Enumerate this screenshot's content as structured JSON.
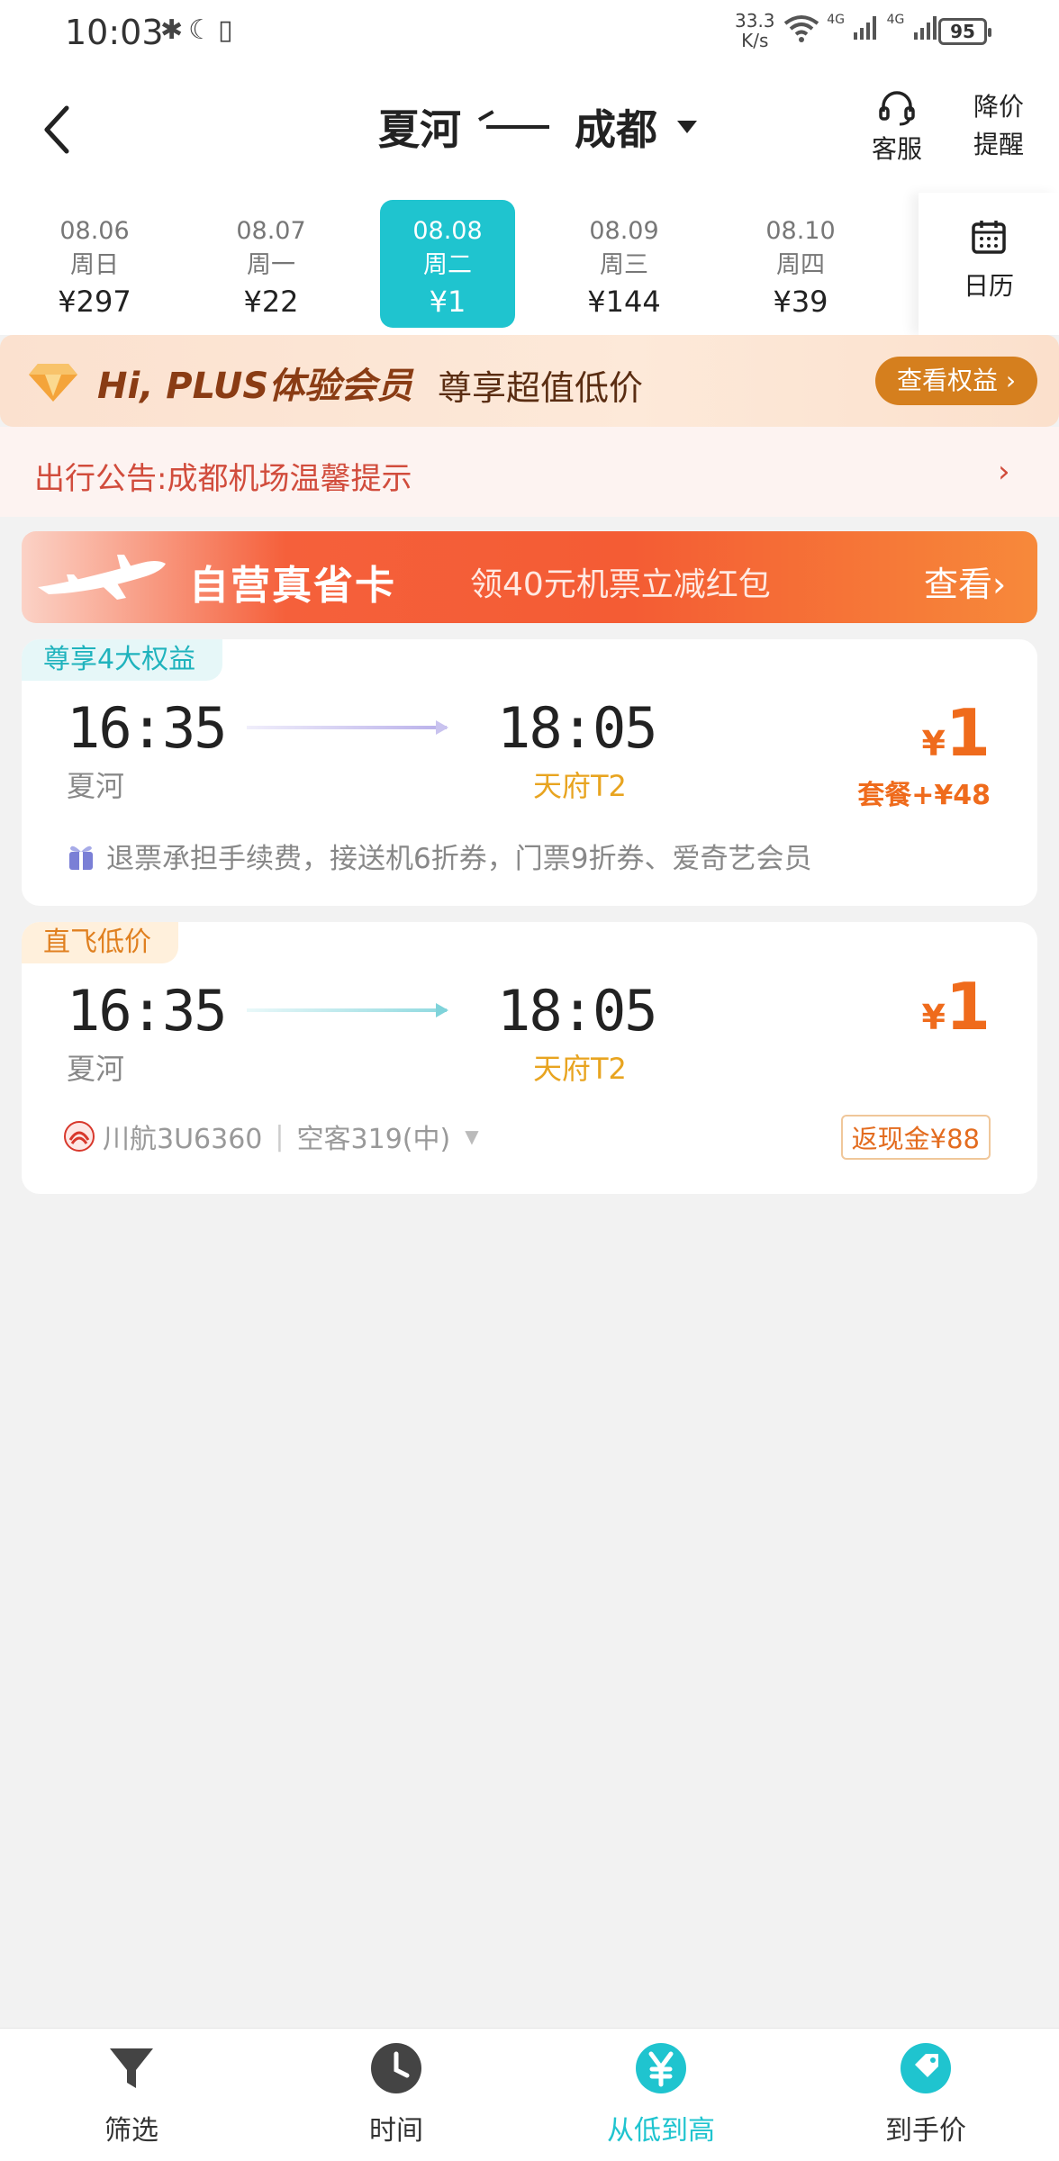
{
  "status_bar": {
    "time": "10:03",
    "net_speed_value": "33.3",
    "net_speed_unit": "K/s",
    "network_1": "4G",
    "network_2": "4G",
    "battery": "95"
  },
  "header": {
    "from": "夏河",
    "to": "成都",
    "service_label": "客服",
    "remind_label_1": "降价",
    "remind_label_2": "提醒"
  },
  "dates": [
    {
      "date": "08.06",
      "weekday": "周日",
      "price": "¥297"
    },
    {
      "date": "08.07",
      "weekday": "周一",
      "price": "¥22"
    },
    {
      "date": "08.08",
      "weekday": "周二",
      "price": "¥1",
      "selected": true
    },
    {
      "date": "08.09",
      "weekday": "周三",
      "price": "¥144"
    },
    {
      "date": "08.10",
      "weekday": "周四",
      "price": "¥39"
    }
  ],
  "calendar_label": "日历",
  "plus_banner": {
    "title": "Hi, PLUS体验会员",
    "subtitle": "尊享超值低价",
    "button": "查看权益"
  },
  "notice": {
    "text": "出行公告:成都机场温馨提示",
    "chevron": "›"
  },
  "promo": {
    "title": "自营真省卡",
    "subtitle": "领40元机票立减红包",
    "button": "查看"
  },
  "flights": [
    {
      "tag": "尊享4大权益",
      "dep_time": "16:35",
      "arr_time": "18:05",
      "dep_airport": "夏河",
      "arr_airport": "天府T2",
      "price_symbol": "¥",
      "price": "1",
      "package": "套餐+¥48",
      "benefits": "退票承担手续费，接送机6折券，门票9折券、爱奇艺会员"
    },
    {
      "tag": "直飞低价",
      "dep_time": "16:35",
      "arr_time": "18:05",
      "dep_airport": "夏河",
      "arr_airport": "天府T2",
      "price_symbol": "¥",
      "price": "1",
      "airline": "川航3U6360",
      "aircraft": "空客319(中)",
      "cashback": "返现金¥88"
    }
  ],
  "bottom_nav": [
    {
      "label": "筛选",
      "icon": "filter-icon"
    },
    {
      "label": "时间",
      "icon": "clock-icon"
    },
    {
      "label": "从低到高",
      "icon": "yuan-icon",
      "active": true
    },
    {
      "label": "到手价",
      "icon": "tag-icon"
    }
  ],
  "colors": {
    "accent": "#1fc4cf",
    "price": "#ef6b1c",
    "notice": "#d14c3c"
  }
}
